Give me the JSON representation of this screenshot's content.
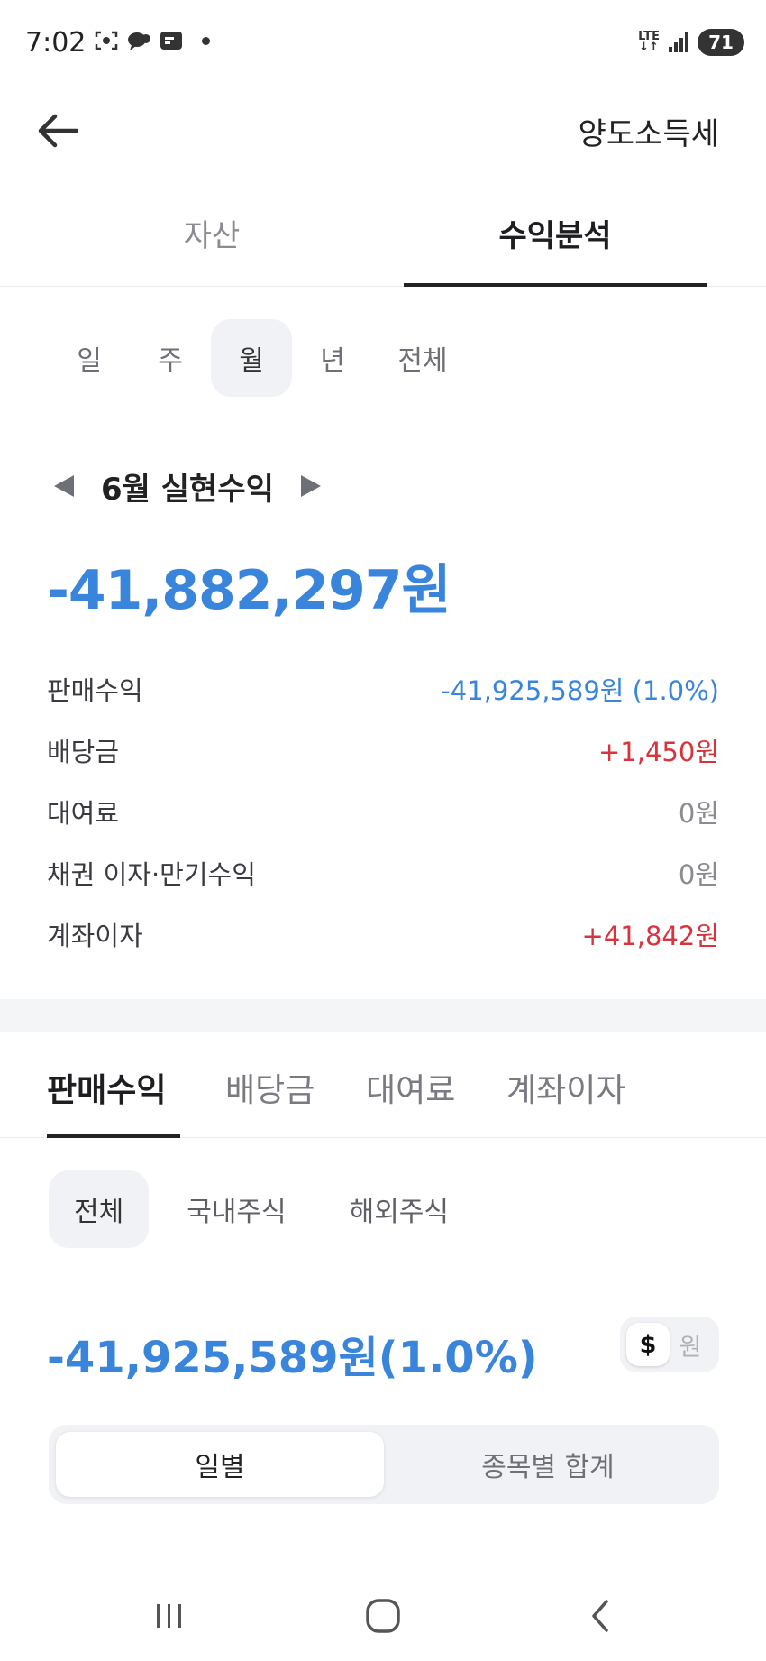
{
  "status": {
    "time": "7:02",
    "network": "LTE",
    "battery": "71"
  },
  "appbar": {
    "title": "양도소득세"
  },
  "main_tabs": [
    {
      "label": "자산"
    },
    {
      "label": "수익분석"
    }
  ],
  "periods": [
    {
      "label": "일"
    },
    {
      "label": "주"
    },
    {
      "label": "월"
    },
    {
      "label": "년"
    },
    {
      "label": "전체"
    }
  ],
  "summary": {
    "month_title": "6월 실현수익",
    "total": "-41,882,297원",
    "rows": [
      {
        "label": "판매수익",
        "value": "-41,925,589원 (1.0%)"
      },
      {
        "label": "배당금",
        "value": "+1,450원"
      },
      {
        "label": "대여료",
        "value": "0원"
      },
      {
        "label": "채권 이자·만기수익",
        "value": "0원"
      },
      {
        "label": "계좌이자",
        "value": "+41,842원"
      }
    ]
  },
  "sub_tabs": [
    {
      "label": "판매수익"
    },
    {
      "label": "배당금"
    },
    {
      "label": "대여료"
    },
    {
      "label": "계좌이자"
    }
  ],
  "markets": [
    {
      "label": "전체"
    },
    {
      "label": "국내주식"
    },
    {
      "label": "해외주식"
    }
  ],
  "sales": {
    "amount": "-41,925,589원(1.0%)",
    "currency_options": [
      {
        "label": "$"
      },
      {
        "label": "원"
      }
    ]
  },
  "segments": [
    {
      "label": "일별"
    },
    {
      "label": "종목별 합계"
    }
  ],
  "colors": {
    "blue": "#3a85dc",
    "red": "#d8343e",
    "gray": "#8b8b93"
  }
}
